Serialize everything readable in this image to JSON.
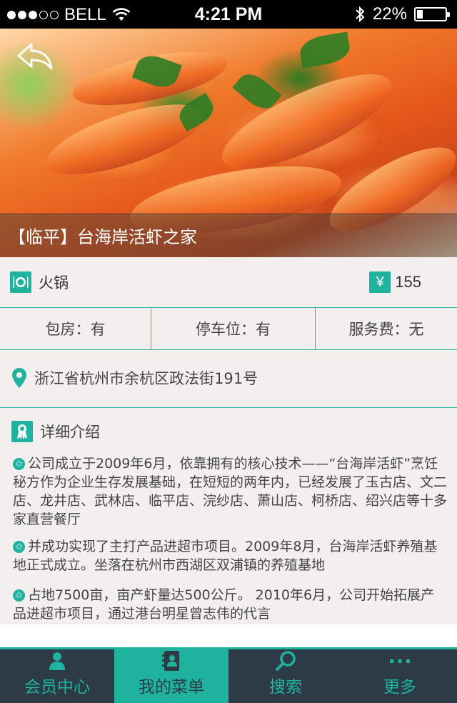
{
  "status_bar": {
    "carrier": "BELL",
    "time": "4:21 PM",
    "battery": "22%",
    "battery_level": 0.22,
    "signal_bars": 3,
    "signal_total": 5
  },
  "restaurant": {
    "title": "【临平】台海岸活虾之家",
    "category": "火锅",
    "currency_symbol": "¥",
    "price": "155",
    "facilities": [
      {
        "label": "包房：有"
      },
      {
        "label": "停车位：有"
      },
      {
        "label": "服务费：无"
      }
    ],
    "address": "浙江省杭州市余杭区政法街191号"
  },
  "detail": {
    "heading": "详细介绍",
    "paragraphs": [
      "公司成立于2009年6月，依靠拥有的核心技术——“台海岸活虾”烹饪秘方作为企业生存发展基础，在短短的两年内，已经发展了玉古店、文二店、龙井店、武林店、临平店、浣纱店、萧山店、柯桥店、绍兴店等十多家直营餐厅",
      "并成功实现了主打产品进超市项目。2009年8月，台海岸活虾养殖基地正式成立。坐落在杭州市西湖区双浦镇的养殖基地",
      "占地7500亩，亩产虾量达500公斤。 2010年6月，公司开始拓展产品进超市项目，通过港台明星曾志伟的代言"
    ]
  },
  "tabbar": {
    "tabs": [
      {
        "label": "会员中心",
        "icon": "user-icon",
        "active": false
      },
      {
        "label": "我的菜单",
        "icon": "menu-book-icon",
        "active": true
      },
      {
        "label": "搜索",
        "icon": "search-icon",
        "active": false
      },
      {
        "label": "更多",
        "icon": "more-icon",
        "active": false
      }
    ]
  },
  "colors": {
    "accent": "#1fb39f",
    "tabbar_bg": "#2d3b47",
    "page_bg": "#f2efee"
  }
}
